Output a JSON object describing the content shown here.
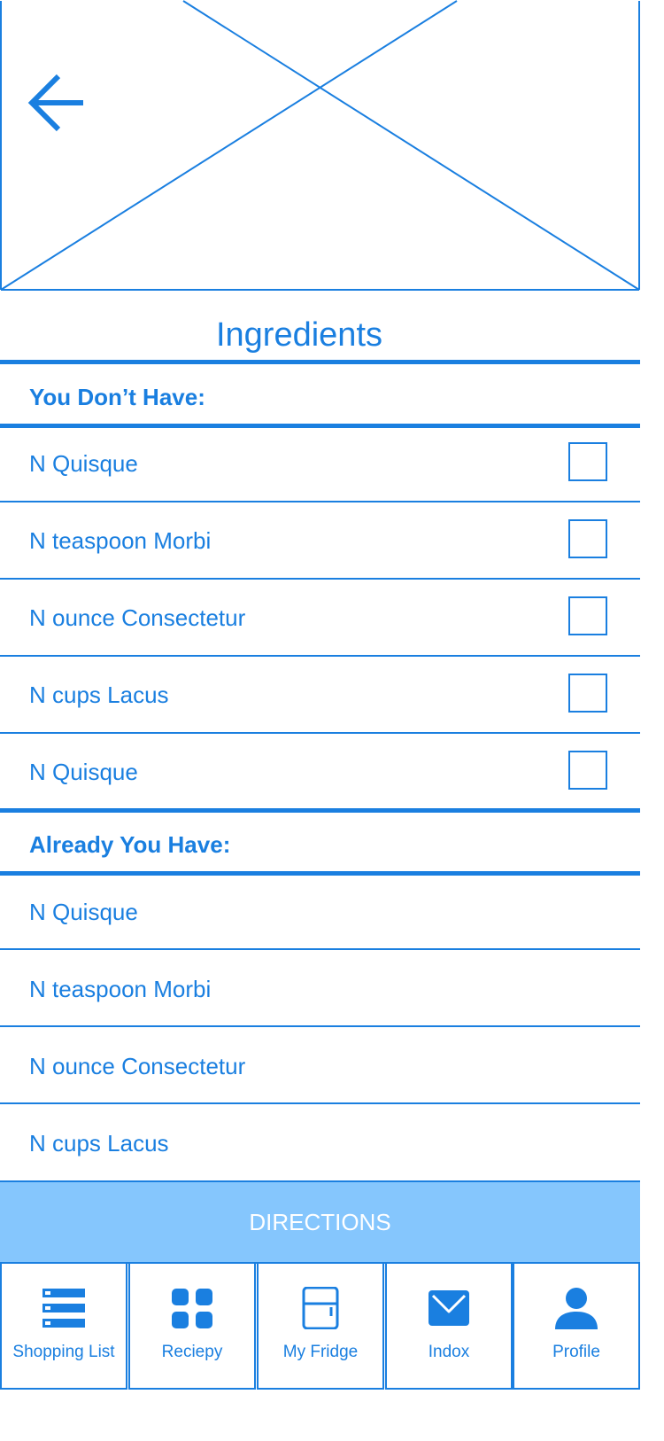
{
  "header": {
    "back_icon": "arrow-left-icon",
    "image_placeholder": "image-placeholder"
  },
  "title": "Ingredients",
  "missing_section": {
    "label": "You Don’t Have:",
    "items": [
      {
        "text": "N Quisque",
        "checked": false
      },
      {
        "text": "N teaspoon Morbi",
        "checked": false
      },
      {
        "text": "N ounce Consectetur",
        "checked": false
      },
      {
        "text": "N cups Lacus",
        "checked": false
      },
      {
        "text": "N Quisque",
        "checked": false
      }
    ]
  },
  "have_section": {
    "label": "Already You Have:",
    "items": [
      {
        "text": "N Quisque"
      },
      {
        "text": "N teaspoon Morbi"
      },
      {
        "text": "N ounce Consectetur"
      },
      {
        "text": "N cups Lacus"
      }
    ]
  },
  "directions_label": "DIRECTIONS",
  "tabs": [
    {
      "label": "Shopping List",
      "icon": "list-icon"
    },
    {
      "label": "Reciepy",
      "icon": "grid-icon"
    },
    {
      "label": "My Fridge",
      "icon": "fridge-icon"
    },
    {
      "label": "Indox",
      "icon": "envelope-icon"
    },
    {
      "label": "Profile",
      "icon": "person-icon"
    }
  ],
  "colors": {
    "accent": "#1a7fe0",
    "button_bg": "#85c6fd",
    "button_text": "#ffffff",
    "background": "#ffffff"
  }
}
